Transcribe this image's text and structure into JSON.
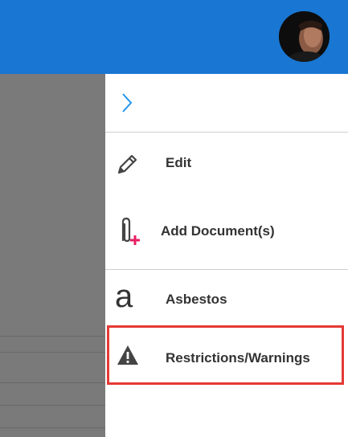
{
  "header": {
    "avatar_icon": "user-avatar"
  },
  "panel": {
    "collapse_icon": "chevron-right-icon",
    "items": [
      {
        "label": "Edit",
        "icon": "pencil-icon"
      },
      {
        "label": "Add Document(s)",
        "icon": "paperclip-plus-icon"
      },
      {
        "label": "Asbestos",
        "icon": "letter-a-icon",
        "icon_text": "a"
      },
      {
        "label": "Restrictions/Warnings",
        "icon": "warning-triangle-icon",
        "highlighted": true
      }
    ]
  },
  "colors": {
    "header_bg": "#1976d2",
    "chevron": "#2196f3",
    "highlight_border": "#e53935",
    "attach_plus": "#e91e63"
  }
}
